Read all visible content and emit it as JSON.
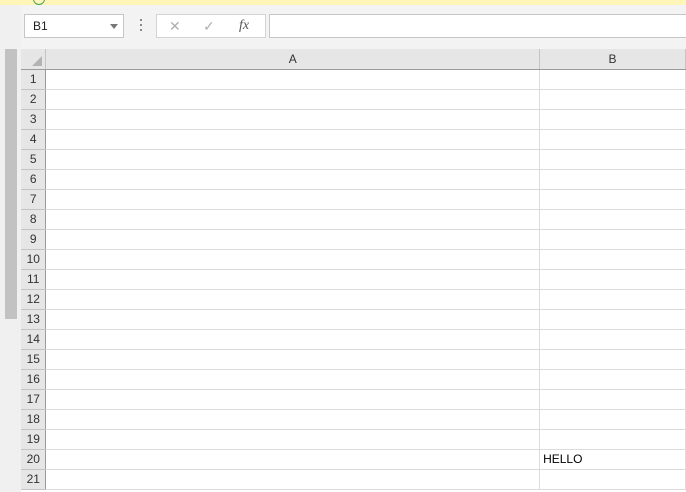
{
  "name_box": {
    "value": "B1"
  },
  "formula_bar": {
    "cancel_icon": "x-icon",
    "enter_icon": "check-icon",
    "function_label": "fx",
    "value": ""
  },
  "columns": [
    "A",
    "B"
  ],
  "rows": [
    {
      "num": "1",
      "cells": [
        "",
        ""
      ]
    },
    {
      "num": "2",
      "cells": [
        "",
        ""
      ]
    },
    {
      "num": "3",
      "cells": [
        "",
        ""
      ]
    },
    {
      "num": "4",
      "cells": [
        "",
        ""
      ]
    },
    {
      "num": "5",
      "cells": [
        "",
        ""
      ]
    },
    {
      "num": "6",
      "cells": [
        "",
        ""
      ]
    },
    {
      "num": "7",
      "cells": [
        "",
        ""
      ]
    },
    {
      "num": "8",
      "cells": [
        "",
        ""
      ]
    },
    {
      "num": "9",
      "cells": [
        "",
        ""
      ]
    },
    {
      "num": "10",
      "cells": [
        "",
        ""
      ]
    },
    {
      "num": "11",
      "cells": [
        "",
        ""
      ]
    },
    {
      "num": "12",
      "cells": [
        "",
        ""
      ]
    },
    {
      "num": "13",
      "cells": [
        "",
        ""
      ]
    },
    {
      "num": "14",
      "cells": [
        "",
        ""
      ]
    },
    {
      "num": "15",
      "cells": [
        "",
        ""
      ]
    },
    {
      "num": "16",
      "cells": [
        "",
        ""
      ]
    },
    {
      "num": "17",
      "cells": [
        "",
        ""
      ]
    },
    {
      "num": "18",
      "cells": [
        "",
        ""
      ]
    },
    {
      "num": "19",
      "cells": [
        "",
        ""
      ]
    },
    {
      "num": "20",
      "cells": [
        "",
        "HELLO"
      ]
    },
    {
      "num": "21",
      "cells": [
        "",
        ""
      ]
    }
  ]
}
